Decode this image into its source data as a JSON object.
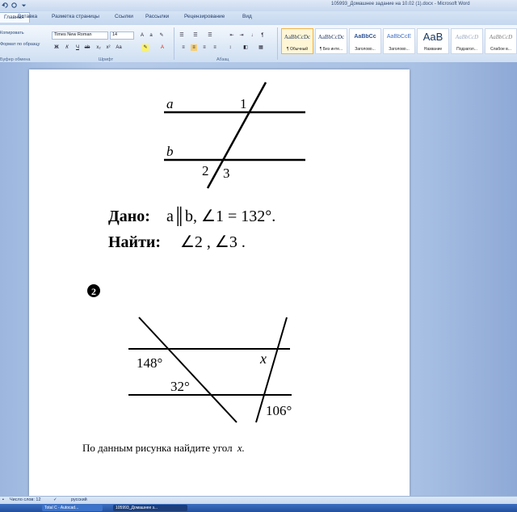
{
  "window": {
    "title": "105993_Домашнее задание на 10.02 (1).docx - Microsoft Word"
  },
  "ribbon_tabs": [
    "Главная",
    "Вставка",
    "Разметка страницы",
    "Ссылки",
    "Рассылки",
    "Рецензирование",
    "Вид"
  ],
  "ribbon": {
    "clipboard": {
      "copy_label": "Копировать",
      "format_painter_label": "Формат по образцу",
      "group_label": "Буфер обмена"
    },
    "font": {
      "name": "Times New Roman",
      "size": "14",
      "group_label": "Шрифт"
    },
    "paragraph": {
      "group_label": "Абзац"
    },
    "styles": [
      {
        "sample": "AaBbCcDc",
        "name": "¶ Обычный",
        "active": true
      },
      {
        "sample": "AaBbCcDc",
        "name": "¶ Без инте...",
        "active": false
      },
      {
        "sample": "AaBbCc",
        "name": "Заголово...",
        "active": false
      },
      {
        "sample": "AaBbCcE",
        "name": "Заголово...",
        "active": false
      },
      {
        "sample": "AaB",
        "name": "Название",
        "active": false
      },
      {
        "sample": "AaBbCcD",
        "name": "Подзагол...",
        "active": false
      },
      {
        "sample": "AaBbCcD",
        "name": "Слабое в...",
        "active": false
      }
    ]
  },
  "document": {
    "problem1": {
      "line_a_label": "a",
      "line_b_label": "b",
      "angle1_label": "1",
      "angle2_label": "2",
      "angle3_label": "3",
      "given_label": "Дано:",
      "given_expr": "a║b, ∠1 = 132°.",
      "find_label": "Найти:",
      "find_expr": "∠2 ,  ∠3 ."
    },
    "problem2": {
      "number": "2",
      "angle_148": "148°",
      "angle_32": "32°",
      "angle_x": "x",
      "angle_106": "106°",
      "task_text": "По данным рисунка найдите угол",
      "task_var": "x."
    }
  },
  "status_bar": {
    "words": "Число слов: 12",
    "language": "русский"
  },
  "taskbar": {
    "items": [
      "Total C - Autocad...",
      "105993_Домашнее з..."
    ]
  }
}
